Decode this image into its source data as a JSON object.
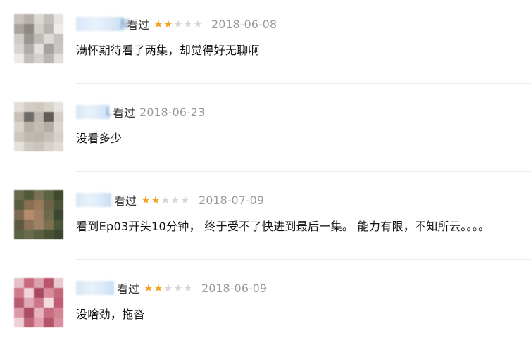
{
  "colors": {
    "star_on": "#f4a21c",
    "star_off": "#d6d6d6",
    "date": "#9a9a9a",
    "divider": "#eaeaea"
  },
  "reviews": [
    {
      "action": "看过",
      "rating": 2,
      "max_rating": 5,
      "date": "2018-06-08",
      "comment": "满怀期待看了两集，却觉得好无聊啊",
      "avatar_palette": [
        "#c9c2bd",
        "#b6b0ac",
        "#dcd8d4",
        "#c4bfbb",
        "#e6e3e1",
        "#a9a39f",
        "#8e8884",
        "#d2ceca",
        "#b8b3af",
        "#efedeb",
        "#cfcbc7",
        "#9c9692",
        "#bfbab6",
        "#dedad7",
        "#c8c3bf",
        "#d8d4d1",
        "#b1aca8",
        "#e4e1df",
        "#a6a19d",
        "#cac6c2",
        "#ecebe9",
        "#c3beba",
        "#d5d1ce",
        "#bab5b1",
        "#e1dedb"
      ]
    },
    {
      "action": "看过",
      "rating": 0,
      "max_rating": 5,
      "date": "2018-06-23",
      "comment": "没看多少",
      "avatar_palette": [
        "#e2ddd7",
        "#d3ccc4",
        "#cfc8c0",
        "#d8d2cb",
        "#e7e3de",
        "#c9c1b8",
        "#6f6b66",
        "#bdb6ae",
        "#5e5a55",
        "#d4cec7",
        "#d9d3cc",
        "#b8b1a9",
        "#c4bdb5",
        "#b3aca4",
        "#dcd6cf",
        "#cec7bf",
        "#c0b9b1",
        "#bcb5ad",
        "#c6bfb7",
        "#d6d0c9",
        "#e4e0db",
        "#d1cac2",
        "#cbc4bc",
        "#d7d1ca",
        "#e0dbd5"
      ]
    },
    {
      "action": "看过",
      "rating": 2,
      "max_rating": 5,
      "date": "2018-07-09",
      "comment": "看到Ep03开头10分钟， 终于受不了快进到最后一集。 能力有限，不知所云。。。。",
      "avatar_palette": [
        "#6a6a4a",
        "#4e5a3a",
        "#7a7254",
        "#5b6443",
        "#3f4a2f",
        "#565e40",
        "#8a6e52",
        "#9b7a5c",
        "#6e6248",
        "#4a5436",
        "#7d6a50",
        "#b48c6c",
        "#a37f62",
        "#6b6a4c",
        "#3d4630",
        "#5c5a40",
        "#8c7258",
        "#9e8266",
        "#7a7050",
        "#4c5538",
        "#5a6244",
        "#6a6a4e",
        "#58603f",
        "#4a5236",
        "#3c4530"
      ]
    },
    {
      "action": "看过",
      "rating": 2,
      "max_rating": 5,
      "date": "2018-06-09",
      "comment": "没啥劲，拖沓",
      "avatar_palette": [
        "#e7bfc7",
        "#c96a7e",
        "#dba3b0",
        "#b9566c",
        "#eac9d0",
        "#d07a8c",
        "#f0d4da",
        "#a84860",
        "#d98c9c",
        "#c4687c",
        "#b85a70",
        "#e2a8b5",
        "#cf7588",
        "#f2dde1",
        "#c05f74",
        "#dc98a7",
        "#aa4c62",
        "#e6b3bf",
        "#c86e82",
        "#d48494",
        "#efd0d7",
        "#bf6378",
        "#e0a0ae",
        "#b35468",
        "#d7909f"
      ]
    }
  ]
}
